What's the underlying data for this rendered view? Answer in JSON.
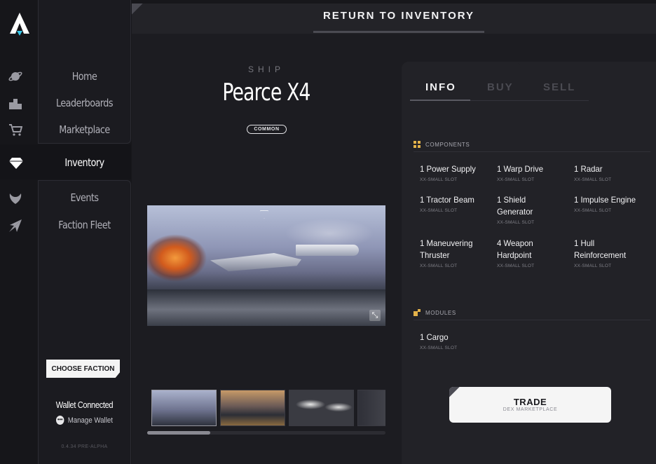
{
  "nav": {
    "items": [
      {
        "label": "Home",
        "icon": "planet-icon"
      },
      {
        "label": "Leaderboards",
        "icon": "podium-icon"
      },
      {
        "label": "Marketplace",
        "icon": "cart-icon"
      },
      {
        "label": "Inventory",
        "icon": "diamond-icon"
      },
      {
        "label": "Events",
        "icon": "phoenix-icon"
      },
      {
        "label": "Faction Fleet",
        "icon": "fleet-icon"
      }
    ],
    "active": "Inventory",
    "choose_faction": "CHOOSE FACTION",
    "wallet_status": "Wallet Connected",
    "manage_wallet": "Manage Wallet",
    "version": "0.4.34 PRE-ALPHA"
  },
  "header": {
    "return_label": "RETURN TO INVENTORY"
  },
  "ship": {
    "kicker": "SHIP",
    "name": "Pearce X4",
    "rarity": "COMMON"
  },
  "gallery": {
    "thumbnail_count": 4,
    "selected_index": 0
  },
  "tabs": [
    {
      "label": "INFO",
      "active": true
    },
    {
      "label": "BUY",
      "active": false
    },
    {
      "label": "SELL",
      "active": false
    }
  ],
  "components": {
    "title": "COMPONENTS",
    "items": [
      {
        "name": "1 Power Supply",
        "slot": "XX-SMALL SLOT"
      },
      {
        "name": "1 Warp Drive",
        "slot": "XX-SMALL SLOT"
      },
      {
        "name": "1 Radar",
        "slot": "XX-SMALL SLOT"
      },
      {
        "name": "1 Tractor Beam",
        "slot": "XX-SMALL SLOT"
      },
      {
        "name": "1 Shield Generator",
        "slot": "XX-SMALL SLOT"
      },
      {
        "name": "1 Impulse Engine",
        "slot": "XX-SMALL SLOT"
      },
      {
        "name": "1 Maneuvering Thruster",
        "slot": "XX-SMALL SLOT"
      },
      {
        "name": "4 Weapon Hardpoint",
        "slot": "XX-SMALL SLOT"
      },
      {
        "name": "1 Hull Reinforcement",
        "slot": "XX-SMALL SLOT"
      }
    ]
  },
  "modules": {
    "title": "MODULES",
    "items": [
      {
        "name": "1 Cargo",
        "slot": "XX-SMALL SLOT"
      }
    ]
  },
  "trade": {
    "title": "TRADE",
    "subtitle": "DEX MARKETPLACE"
  },
  "colors": {
    "background": "#17171b",
    "panel": "#222227",
    "accent_yellow": "#e3b24a",
    "text": "#f2f2f4",
    "muted": "#808088"
  }
}
